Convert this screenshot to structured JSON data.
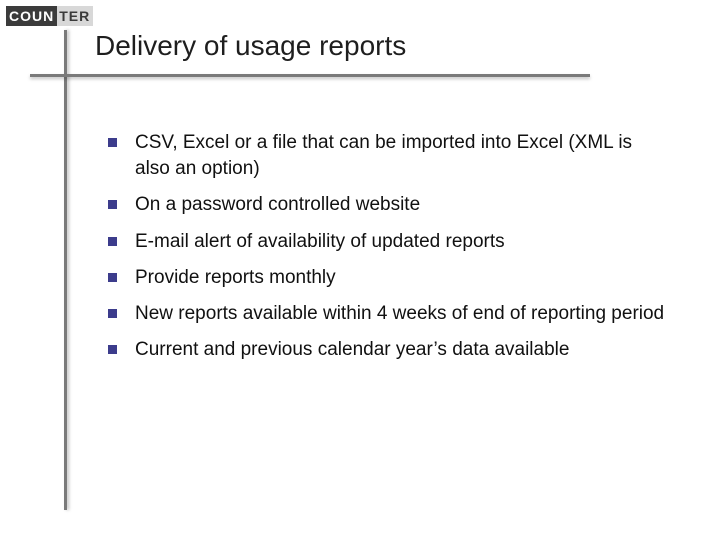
{
  "logo": {
    "part1": "COUN",
    "part2": "TER"
  },
  "title": "Delivery of usage reports",
  "bullets": {
    "b0": "CSV, Excel or a file that can be imported into Excel (XML is also an option)",
    "b1": "On a password controlled website",
    "b2": "E-mail alert of availability of updated reports",
    "b3": "Provide reports monthly",
    "b4": "New reports available within 4 weeks of end of reporting period",
    "b5": "Current and previous calendar year’s data available"
  },
  "colors": {
    "accent": "#3c3c8c",
    "rule": "#7a7a7a"
  }
}
